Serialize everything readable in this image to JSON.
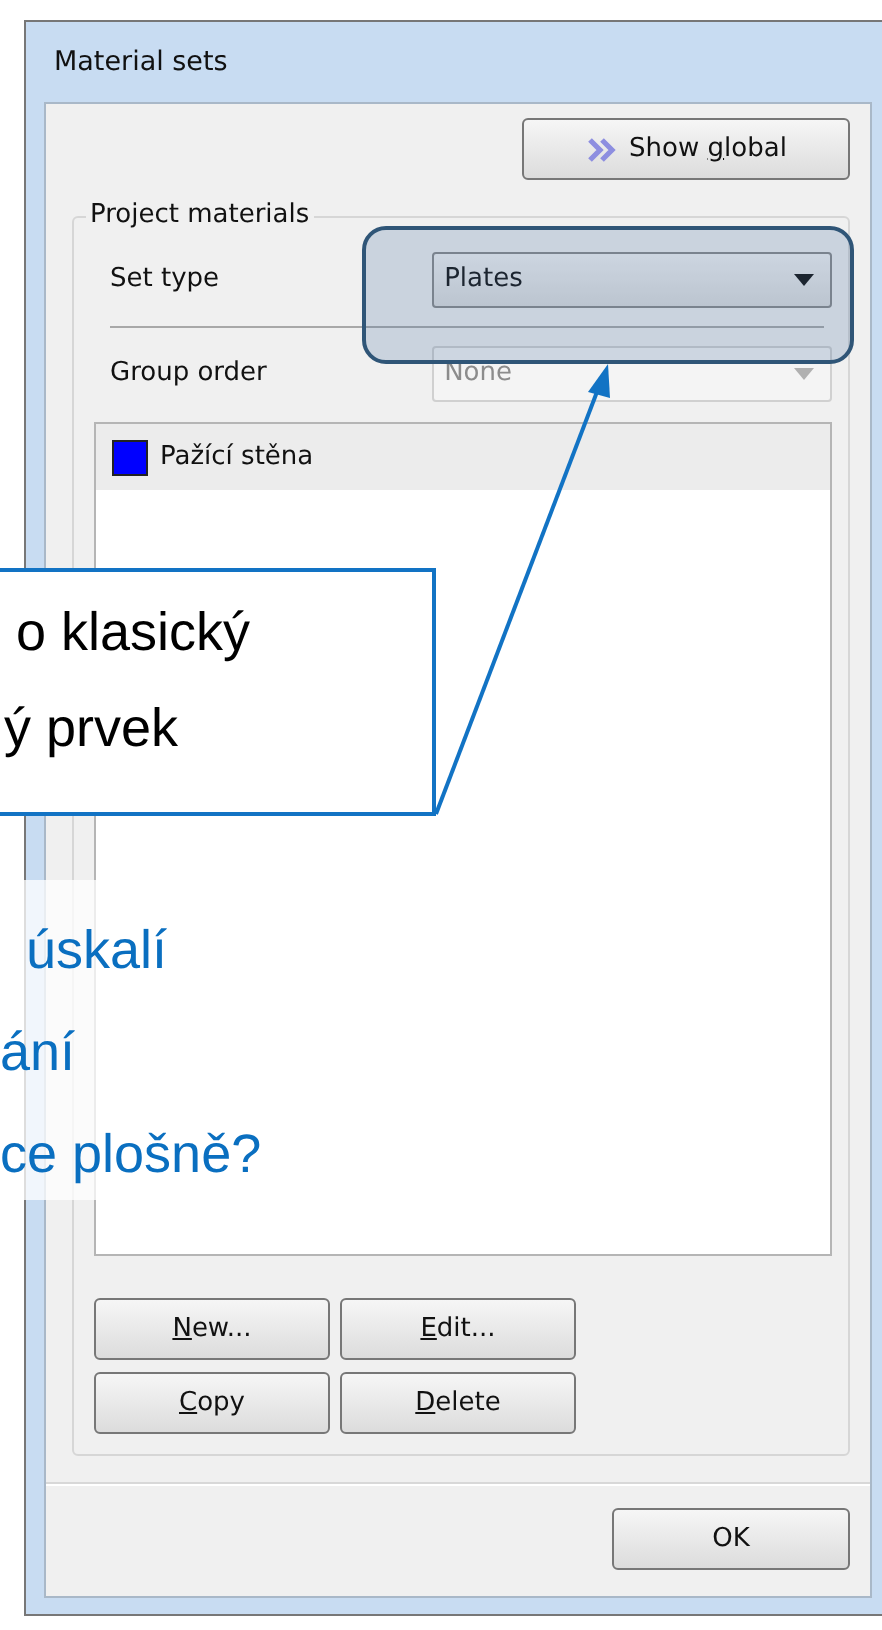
{
  "window": {
    "title": "Material sets"
  },
  "show_global_button": {
    "before": "Show ",
    "access_key": "g",
    "after": "lobal"
  },
  "project_materials": {
    "title": "Project materials",
    "set_type": {
      "label": "Set type",
      "value": "Plates",
      "disabled": false
    },
    "group_order": {
      "label": "Group order",
      "value": "None",
      "disabled": true
    },
    "materials": [
      {
        "name": "Pažící stěna",
        "color": "#0000ff",
        "selected": true
      }
    ],
    "buttons": [
      {
        "access_key": "N",
        "after": "ew..."
      },
      {
        "access_key": "E",
        "after": "dit..."
      },
      {
        "access_key": "C",
        "after": "opy"
      },
      {
        "access_key": "D",
        "after": "elete"
      }
    ]
  },
  "ok_button": {
    "label": "OK"
  },
  "callout": {
    "lines": [
      "o klasický",
      "ý prvek"
    ]
  },
  "note": {
    "lines": [
      "úskalí",
      "ání",
      "ce plošně?"
    ]
  }
}
